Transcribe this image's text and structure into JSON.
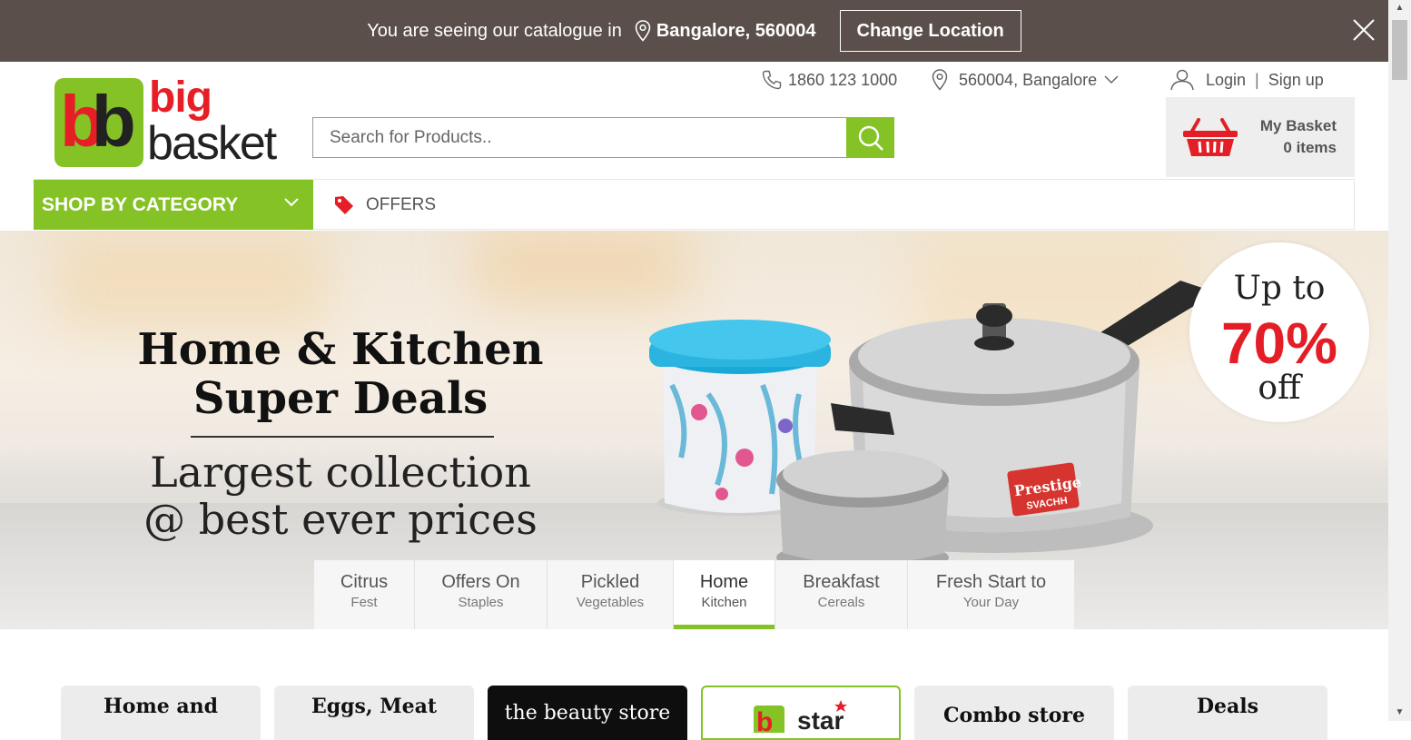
{
  "location_bar": {
    "message": "You are seeing our catalogue in",
    "city": "Bangalore, 560004",
    "change_button": "Change Location"
  },
  "header": {
    "logo_word1": "big",
    "logo_word2": "basket",
    "phone": "1860 123 1000",
    "pincode": "560004, Bangalore",
    "login": "Login",
    "separator": "|",
    "signup": "Sign up",
    "search_placeholder": "Search for Products..",
    "basket_title": "My Basket",
    "basket_count": "0 items"
  },
  "nav": {
    "shop_by_category": "SHOP BY CATEGORY",
    "offers": "OFFERS"
  },
  "banner": {
    "title_line1": "Home & Kitchen",
    "title_line2": "Super Deals",
    "subtitle_line1": "Largest collection",
    "subtitle_line2": "@ best ever prices",
    "promo_upto": "Up to",
    "promo_pct": "70%",
    "promo_off": "off",
    "product_brand": "Prestige",
    "product_model": "SVACHH",
    "tabs": [
      {
        "line1": "Citrus",
        "line2": "Fest",
        "active": false
      },
      {
        "line1": "Offers On",
        "line2": "Staples",
        "active": false
      },
      {
        "line1": "Pickled",
        "line2": "Vegetables",
        "active": false
      },
      {
        "line1": "Home",
        "line2": "Kitchen",
        "active": true
      },
      {
        "line1": "Breakfast",
        "line2": "Cereals",
        "active": false
      },
      {
        "line1": "Fresh Start to",
        "line2": "Your Day",
        "active": false
      }
    ]
  },
  "category_cards": [
    {
      "label": "Home and"
    },
    {
      "label": "Eggs, Meat"
    },
    {
      "label": "the beauty store"
    },
    {
      "label": "star"
    },
    {
      "label": "Combo store"
    },
    {
      "label": "Deals"
    }
  ],
  "colors": {
    "brand_green": "#84c225",
    "brand_red": "#e61e25",
    "location_bar_bg": "#5a4f4a"
  }
}
